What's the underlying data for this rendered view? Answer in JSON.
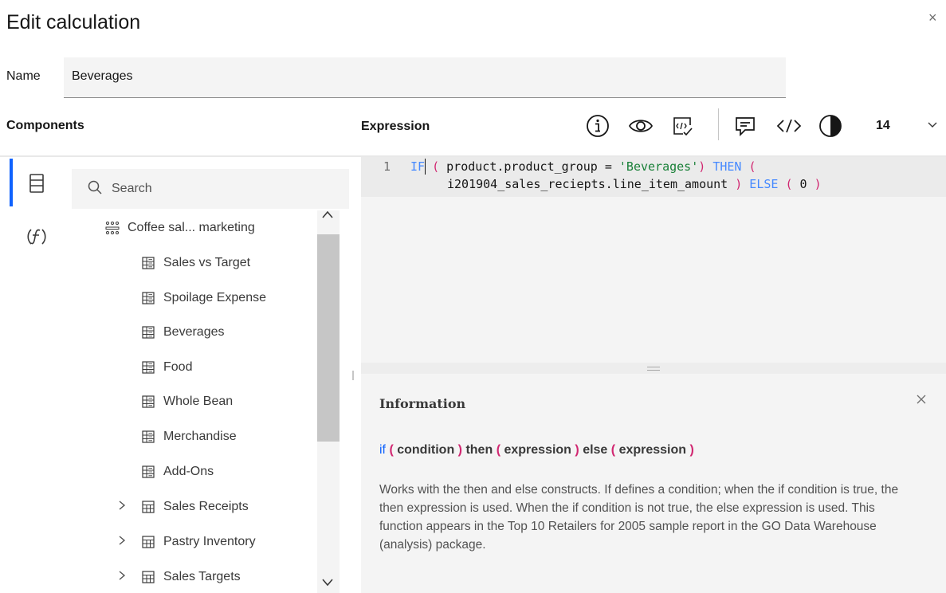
{
  "dialog": {
    "title": "Edit calculation",
    "close_icon": "×"
  },
  "name": {
    "label": "Name",
    "value": "Beverages"
  },
  "components": {
    "label": "Components"
  },
  "search": {
    "placeholder": "Search"
  },
  "tree": {
    "root": "Coffee sal... marketing",
    "items": [
      "Sales vs Target",
      "Spoilage Expense",
      "Beverages",
      "Food",
      "Whole Bean",
      "Merchandise",
      "Add-Ons"
    ],
    "tables": [
      "Sales Receipts",
      "Pastry Inventory",
      "Sales Targets"
    ]
  },
  "expression": {
    "label": "Expression",
    "font_size": "14",
    "line_number": "1",
    "code": {
      "if": "IF",
      "open1": "(",
      "cond": " product.product_group = ",
      "str": "'Beverages'",
      "close1": ")",
      "then": "THEN",
      "open2": "(",
      "expr": "i201904_sales_reciepts.line_item_amount",
      "close2": ")",
      "else": "ELSE",
      "open3": "(",
      "zero": " 0 ",
      "close3": ")"
    }
  },
  "information": {
    "title": "Information",
    "syntax": {
      "if": "if",
      "open": "(",
      "condition": "condition",
      "close": ")",
      "then": "then",
      "expression": "expression",
      "else": "else"
    },
    "description": "Works with the then and else constructs. If defines a condition; when the if condition is true, the then expression is used. When the if condition is not true, the else expression is used. This function appears in the Top 10 Retailers for 2005 sample report in the GO Data Warehouse (analysis) package."
  },
  "colors": {
    "accent": "#0f62fe",
    "keyword": "#4589ff",
    "paren": "#d12771",
    "string": "#198038"
  }
}
